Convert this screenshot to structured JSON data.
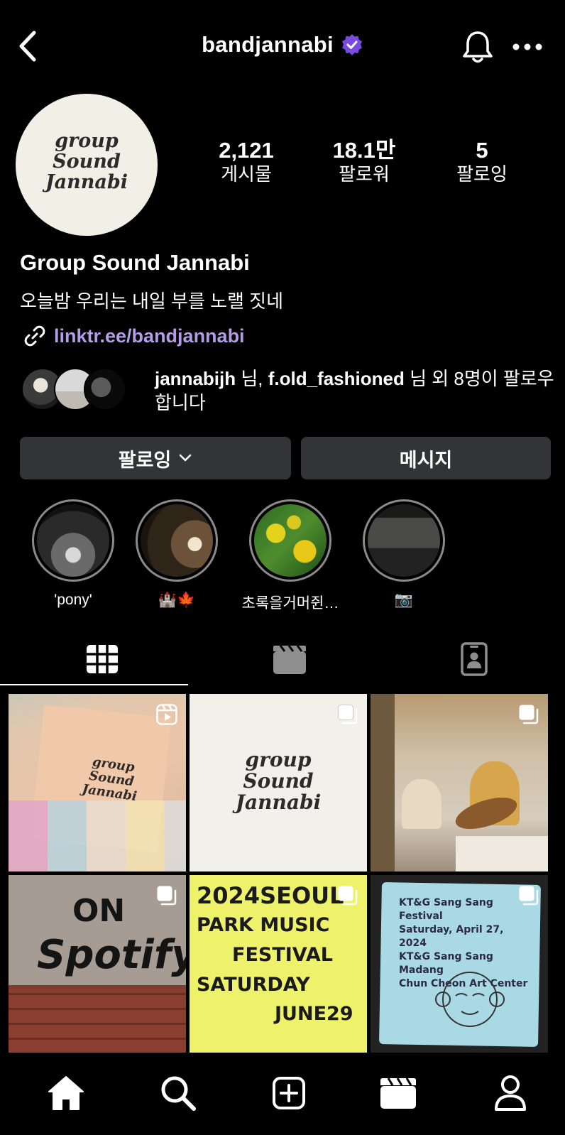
{
  "header": {
    "username": "bandjannabi",
    "verified": true,
    "accent_color": "#7b4bdf"
  },
  "profile": {
    "logo_lines": [
      "group",
      "Sound",
      "Jannabi"
    ],
    "stats": [
      {
        "value": "2,121",
        "label": "게시물"
      },
      {
        "value": "18.1만",
        "label": "팔로워"
      },
      {
        "value": "5",
        "label": "팔로잉"
      }
    ],
    "name": "Group Sound Jannabi",
    "bio": "오늘밤 우리는 내일 부를 노랠 짓네",
    "link": "linktr.ee/bandjannabi",
    "link_color": "#b49ce6",
    "mutual": {
      "user1": "jannabijh",
      "sep1": " 님, ",
      "user2": "f.old_fashioned",
      "rest": " 님 외 8명이 팔로우합니다"
    }
  },
  "actions": {
    "follow_label": "팔로잉",
    "message_label": "메시지"
  },
  "highlights": [
    {
      "label": "'pony'"
    },
    {
      "label": "🏰🍁"
    },
    {
      "label": "초록을거머쥔…"
    },
    {
      "label": "📷"
    }
  ],
  "tabs": [
    "grid-icon",
    "reels-icon",
    "tagged-icon"
  ],
  "grid": {
    "posts": [
      {
        "kind": "reel",
        "text": "group Sound Jannabi"
      },
      {
        "kind": "carousel",
        "text_lines": [
          "group",
          "Sound",
          "Jannabi"
        ]
      },
      {
        "kind": "carousel",
        "text": ""
      },
      {
        "kind": "carousel",
        "text_lines": [
          "ON",
          "Spotify"
        ]
      },
      {
        "kind": "carousel",
        "text_lines": [
          "2024SEOUL",
          "PARK MUSIC",
          "FESTIVAL",
          "SATURDAY",
          "JUNE29"
        ]
      },
      {
        "kind": "carousel",
        "text_lines": [
          "KT&G Sang Sang Festival",
          "Saturday, April 27, 2024",
          "KT&G Sang Sang Madang",
          "Chun Cheon Art Center"
        ]
      }
    ]
  },
  "bottom_nav": [
    "home-icon",
    "search-icon",
    "create-icon",
    "reels-icon",
    "profile-icon"
  ]
}
